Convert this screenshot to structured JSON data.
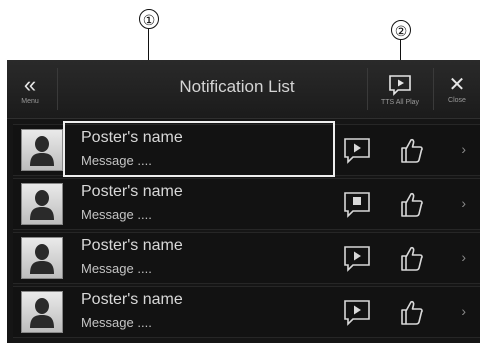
{
  "callouts": [
    "①",
    "②"
  ],
  "header": {
    "menu_label": "Menu",
    "title": "Notification List",
    "tts_label": "TTS All Play",
    "close_label": "Close"
  },
  "notifications": [
    {
      "name": "Poster's name",
      "message": "Message ....",
      "tts_icon": "speech-play-icon"
    },
    {
      "name": "Poster's name",
      "message": "Message ....",
      "tts_icon": "speech-stop-icon"
    },
    {
      "name": "Poster's name",
      "message": "Message ....",
      "tts_icon": "speech-play-icon"
    },
    {
      "name": "Poster's name",
      "message": "Message ....",
      "tts_icon": "speech-play-icon"
    }
  ]
}
